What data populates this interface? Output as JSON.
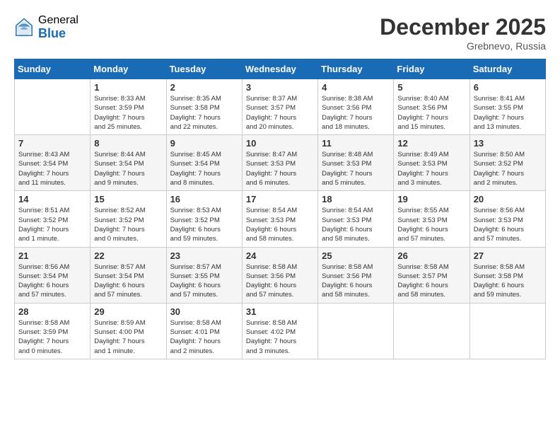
{
  "header": {
    "logo_general": "General",
    "logo_blue": "Blue",
    "month_title": "December 2025",
    "location": "Grebnevo, Russia"
  },
  "days_of_week": [
    "Sunday",
    "Monday",
    "Tuesday",
    "Wednesday",
    "Thursday",
    "Friday",
    "Saturday"
  ],
  "weeks": [
    [
      {
        "day": "",
        "info": ""
      },
      {
        "day": "1",
        "info": "Sunrise: 8:33 AM\nSunset: 3:59 PM\nDaylight: 7 hours\nand 25 minutes."
      },
      {
        "day": "2",
        "info": "Sunrise: 8:35 AM\nSunset: 3:58 PM\nDaylight: 7 hours\nand 22 minutes."
      },
      {
        "day": "3",
        "info": "Sunrise: 8:37 AM\nSunset: 3:57 PM\nDaylight: 7 hours\nand 20 minutes."
      },
      {
        "day": "4",
        "info": "Sunrise: 8:38 AM\nSunset: 3:56 PM\nDaylight: 7 hours\nand 18 minutes."
      },
      {
        "day": "5",
        "info": "Sunrise: 8:40 AM\nSunset: 3:56 PM\nDaylight: 7 hours\nand 15 minutes."
      },
      {
        "day": "6",
        "info": "Sunrise: 8:41 AM\nSunset: 3:55 PM\nDaylight: 7 hours\nand 13 minutes."
      }
    ],
    [
      {
        "day": "7",
        "info": "Sunrise: 8:43 AM\nSunset: 3:54 PM\nDaylight: 7 hours\nand 11 minutes."
      },
      {
        "day": "8",
        "info": "Sunrise: 8:44 AM\nSunset: 3:54 PM\nDaylight: 7 hours\nand 9 minutes."
      },
      {
        "day": "9",
        "info": "Sunrise: 8:45 AM\nSunset: 3:54 PM\nDaylight: 7 hours\nand 8 minutes."
      },
      {
        "day": "10",
        "info": "Sunrise: 8:47 AM\nSunset: 3:53 PM\nDaylight: 7 hours\nand 6 minutes."
      },
      {
        "day": "11",
        "info": "Sunrise: 8:48 AM\nSunset: 3:53 PM\nDaylight: 7 hours\nand 5 minutes."
      },
      {
        "day": "12",
        "info": "Sunrise: 8:49 AM\nSunset: 3:53 PM\nDaylight: 7 hours\nand 3 minutes."
      },
      {
        "day": "13",
        "info": "Sunrise: 8:50 AM\nSunset: 3:52 PM\nDaylight: 7 hours\nand 2 minutes."
      }
    ],
    [
      {
        "day": "14",
        "info": "Sunrise: 8:51 AM\nSunset: 3:52 PM\nDaylight: 7 hours\nand 1 minute."
      },
      {
        "day": "15",
        "info": "Sunrise: 8:52 AM\nSunset: 3:52 PM\nDaylight: 7 hours\nand 0 minutes."
      },
      {
        "day": "16",
        "info": "Sunrise: 8:53 AM\nSunset: 3:52 PM\nDaylight: 6 hours\nand 59 minutes."
      },
      {
        "day": "17",
        "info": "Sunrise: 8:54 AM\nSunset: 3:53 PM\nDaylight: 6 hours\nand 58 minutes."
      },
      {
        "day": "18",
        "info": "Sunrise: 8:54 AM\nSunset: 3:53 PM\nDaylight: 6 hours\nand 58 minutes."
      },
      {
        "day": "19",
        "info": "Sunrise: 8:55 AM\nSunset: 3:53 PM\nDaylight: 6 hours\nand 57 minutes."
      },
      {
        "day": "20",
        "info": "Sunrise: 8:56 AM\nSunset: 3:53 PM\nDaylight: 6 hours\nand 57 minutes."
      }
    ],
    [
      {
        "day": "21",
        "info": "Sunrise: 8:56 AM\nSunset: 3:54 PM\nDaylight: 6 hours\nand 57 minutes."
      },
      {
        "day": "22",
        "info": "Sunrise: 8:57 AM\nSunset: 3:54 PM\nDaylight: 6 hours\nand 57 minutes."
      },
      {
        "day": "23",
        "info": "Sunrise: 8:57 AM\nSunset: 3:55 PM\nDaylight: 6 hours\nand 57 minutes."
      },
      {
        "day": "24",
        "info": "Sunrise: 8:58 AM\nSunset: 3:56 PM\nDaylight: 6 hours\nand 57 minutes."
      },
      {
        "day": "25",
        "info": "Sunrise: 8:58 AM\nSunset: 3:56 PM\nDaylight: 6 hours\nand 58 minutes."
      },
      {
        "day": "26",
        "info": "Sunrise: 8:58 AM\nSunset: 3:57 PM\nDaylight: 6 hours\nand 58 minutes."
      },
      {
        "day": "27",
        "info": "Sunrise: 8:58 AM\nSunset: 3:58 PM\nDaylight: 6 hours\nand 59 minutes."
      }
    ],
    [
      {
        "day": "28",
        "info": "Sunrise: 8:58 AM\nSunset: 3:59 PM\nDaylight: 7 hours\nand 0 minutes."
      },
      {
        "day": "29",
        "info": "Sunrise: 8:59 AM\nSunset: 4:00 PM\nDaylight: 7 hours\nand 1 minute."
      },
      {
        "day": "30",
        "info": "Sunrise: 8:58 AM\nSunset: 4:01 PM\nDaylight: 7 hours\nand 2 minutes."
      },
      {
        "day": "31",
        "info": "Sunrise: 8:58 AM\nSunset: 4:02 PM\nDaylight: 7 hours\nand 3 minutes."
      },
      {
        "day": "",
        "info": ""
      },
      {
        "day": "",
        "info": ""
      },
      {
        "day": "",
        "info": ""
      }
    ]
  ]
}
